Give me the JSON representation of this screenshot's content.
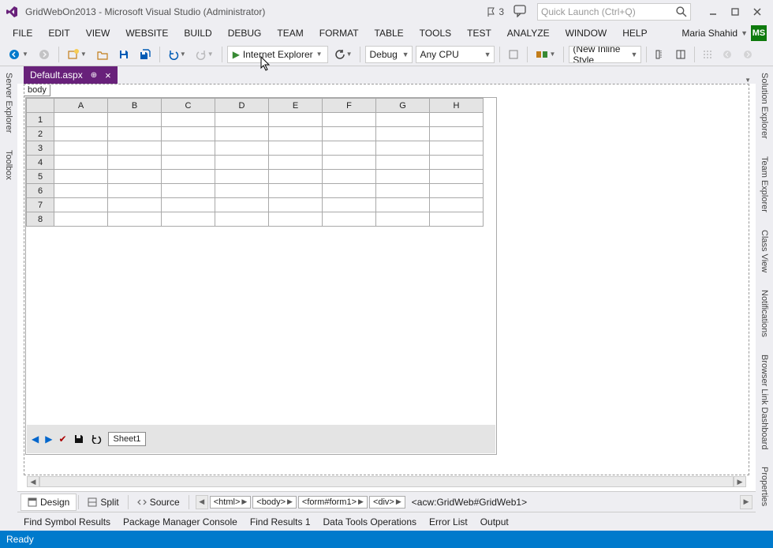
{
  "titlebar": {
    "title": "GridWebOn2013 - Microsoft Visual Studio (Administrator)",
    "notif_count": "3",
    "search_placeholder": "Quick Launch (Ctrl+Q)"
  },
  "menu": {
    "items": [
      "FILE",
      "EDIT",
      "VIEW",
      "WEBSITE",
      "BUILD",
      "DEBUG",
      "TEAM",
      "FORMAT",
      "TABLE",
      "TOOLS",
      "TEST",
      "ANALYZE",
      "WINDOW",
      "HELP"
    ],
    "user": "Maria Shahid",
    "badge": "MS"
  },
  "toolbar": {
    "run_target": "Internet Explorer",
    "config": "Debug",
    "platform": "Any CPU",
    "style": "(New Inline Style"
  },
  "doc_tab": {
    "label": "Default.aspx"
  },
  "body_tag": "body",
  "grid": {
    "cols": [
      "A",
      "B",
      "C",
      "D",
      "E",
      "F",
      "G",
      "H"
    ],
    "rows": [
      "1",
      "2",
      "3",
      "4",
      "5",
      "6",
      "7",
      "8"
    ],
    "sheet": "Sheet1"
  },
  "design_tabs": {
    "design": "Design",
    "split": "Split",
    "source": "Source"
  },
  "breadcrumb": [
    "<html>",
    "<body>",
    "<form#form1>",
    "<div>"
  ],
  "breadcrumb_text": "<acw:GridWeb#GridWeb1>",
  "output_tabs": [
    "Find Symbol Results",
    "Package Manager Console",
    "Find Results 1",
    "Data Tools Operations",
    "Error List",
    "Output"
  ],
  "side_left": [
    "Server Explorer",
    "Toolbox"
  ],
  "side_right": [
    "Solution Explorer",
    "Team Explorer",
    "Class View",
    "Notifications",
    "Browser Link Dashboard",
    "Properties"
  ],
  "status": "Ready"
}
